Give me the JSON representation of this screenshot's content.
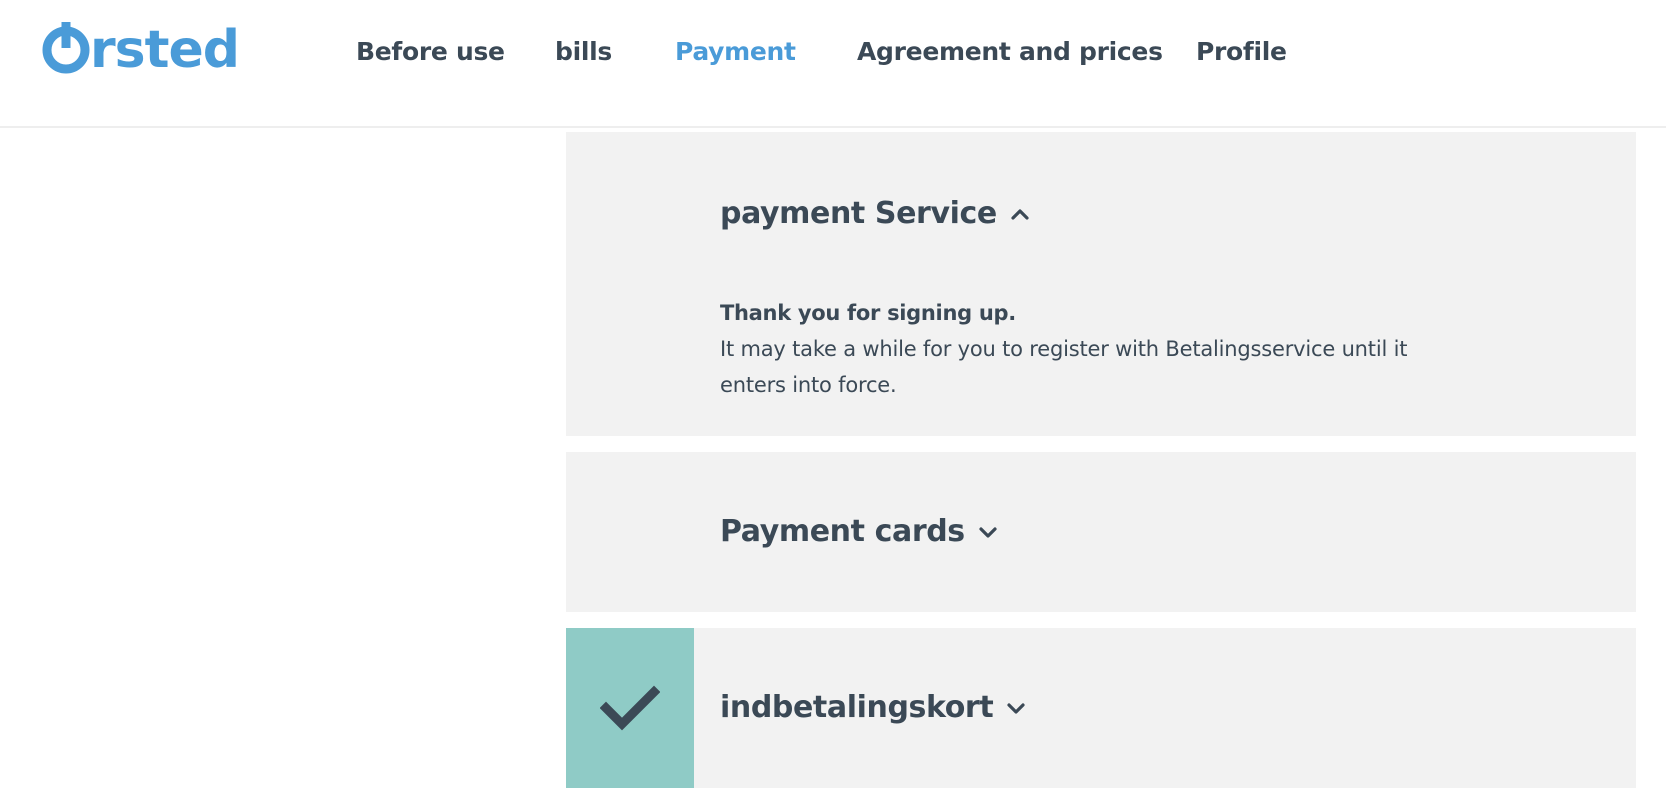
{
  "brand": {
    "logo_text": "rsted",
    "color": "#4a9bd8"
  },
  "nav": {
    "items": [
      {
        "label": "Before use",
        "active": false
      },
      {
        "label": "bills",
        "active": false
      },
      {
        "label": "Payment",
        "active": true
      },
      {
        "label": "Agreement and prices",
        "active": false
      },
      {
        "label": "Profile",
        "active": false
      }
    ]
  },
  "sections": {
    "payment_service": {
      "title": "payment Service",
      "expanded": true,
      "chevron": "chevron-up-icon",
      "message_title": "Thank you for signing up.",
      "message_body": "It may take a while for you to register with Betalingsservice until it enters into force."
    },
    "payment_cards": {
      "title": "Payment cards",
      "expanded": false,
      "chevron": "chevron-down-icon"
    },
    "indbetalingskort": {
      "title": "indbetalingskort",
      "expanded": false,
      "selected": true,
      "chevron": "chevron-down-icon",
      "status_icon": "checkmark-icon"
    }
  },
  "colors": {
    "text": "#3b4956",
    "accent": "#4a9bd8",
    "panel_bg": "#f2f2f2",
    "check_bg": "#8fcbc6"
  }
}
